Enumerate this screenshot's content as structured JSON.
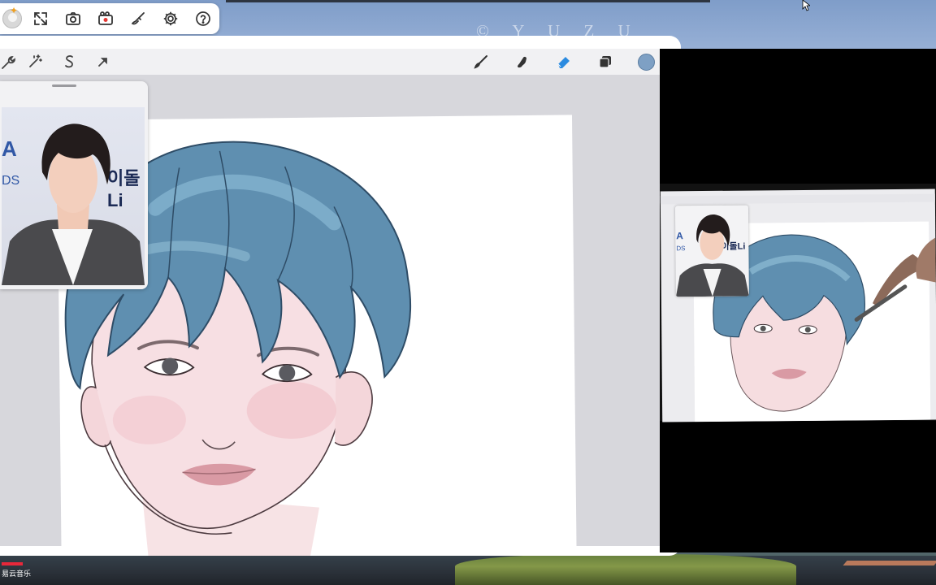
{
  "desktop": {
    "watermark": "© Y U Z U",
    "taskbar_app_label": "易云音乐"
  },
  "float_toolbar": {
    "buttons": [
      {
        "name": "avatar",
        "icon": "user-avatar-icon"
      },
      {
        "name": "fullscreen",
        "icon": "expand-icon"
      },
      {
        "name": "screenshot",
        "icon": "camera-icon"
      },
      {
        "name": "record",
        "icon": "video-record-icon"
      },
      {
        "name": "brush",
        "icon": "brush-icon"
      },
      {
        "name": "settings",
        "icon": "gear-icon"
      },
      {
        "name": "help",
        "icon": "help-icon"
      }
    ]
  },
  "procreate": {
    "left_tools": [
      {
        "name": "actions",
        "icon": "wrench-icon"
      },
      {
        "name": "adjustments",
        "icon": "magic-wand-icon"
      },
      {
        "name": "selection",
        "icon": "selection-s-icon"
      },
      {
        "name": "transform",
        "icon": "arrow-cursor-icon"
      }
    ],
    "right_tools": [
      {
        "name": "brush",
        "icon": "brush-icon"
      },
      {
        "name": "smudge",
        "icon": "smudge-icon"
      },
      {
        "name": "eraser",
        "icon": "eraser-icon",
        "active": true
      },
      {
        "name": "layers",
        "icon": "layers-icon"
      },
      {
        "name": "color",
        "icon": "color-swatch-icon",
        "color": "#7ea0c4"
      }
    ],
    "reference": {
      "photo_text_a": "A",
      "photo_text_b": "이돌Li",
      "photo_text_c": "DS"
    },
    "colors": {
      "hair": "#5f8fb0",
      "hair_dark": "#2e4c66",
      "skin": "#f6dde0",
      "lips": "#d69aa2"
    }
  },
  "video": {
    "mini_reference_text": "이돌Li",
    "mini_reference_text_b": "A",
    "mini_reference_text_c": "DS"
  }
}
